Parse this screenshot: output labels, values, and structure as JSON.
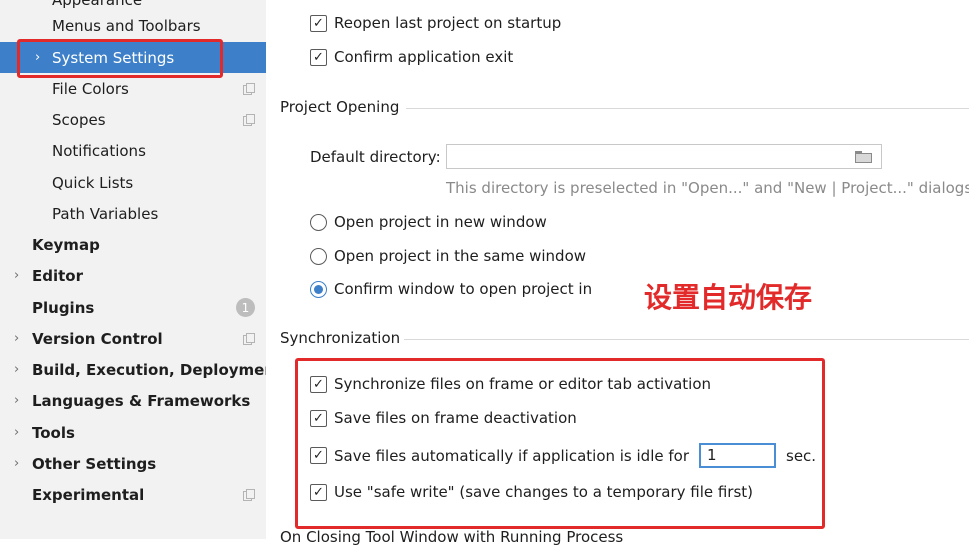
{
  "sidebar": {
    "partial_top_label": "Appearance",
    "items": [
      {
        "label": "Menus and Toolbars",
        "level": "sub"
      },
      {
        "label": "System Settings",
        "level": "sub",
        "selected": true,
        "arrow": "›"
      },
      {
        "label": "File Colors",
        "level": "sub",
        "copy_icon": true
      },
      {
        "label": "Scopes",
        "level": "sub",
        "copy_icon": true
      },
      {
        "label": "Notifications",
        "level": "sub"
      },
      {
        "label": "Quick Lists",
        "level": "sub"
      },
      {
        "label": "Path Variables",
        "level": "sub"
      },
      {
        "label": "Keymap",
        "level": "top"
      },
      {
        "label": "Editor",
        "level": "top",
        "arrow": "›"
      },
      {
        "label": "Plugins",
        "level": "top",
        "badge": "1"
      },
      {
        "label": "Version Control",
        "level": "top",
        "arrow": "›",
        "copy_icon": true
      },
      {
        "label": "Build, Execution, Deployment",
        "level": "top",
        "arrow": "›"
      },
      {
        "label": "Languages & Frameworks",
        "level": "top",
        "arrow": "›"
      },
      {
        "label": "Tools",
        "level": "top",
        "arrow": "›"
      },
      {
        "label": "Other Settings",
        "level": "top",
        "arrow": "›"
      },
      {
        "label": "Experimental",
        "level": "top",
        "copy_icon": true
      }
    ]
  },
  "startup": {
    "reopen_label": "Reopen last project on startup",
    "confirm_exit_label": "Confirm application exit"
  },
  "project_opening": {
    "title": "Project Opening",
    "default_dir_label": "Default directory:",
    "default_dir_value": "",
    "hint": "This directory is preselected in \"Open...\" and \"New | Project...\" dialogs.",
    "radio_new_window": "Open project in new window",
    "radio_same_window": "Open project in the same window",
    "radio_confirm": "Confirm window to open project in"
  },
  "annotation": "设置自动保存",
  "synchronization": {
    "title": "Synchronization",
    "sync_label": "Synchronize files on frame or editor tab activation",
    "save_deactivation_label": "Save files on frame deactivation",
    "save_idle_label": "Save files automatically if application is idle for",
    "idle_value": "1",
    "idle_unit": "sec.",
    "safe_write_label": "Use \"safe write\" (save changes to a temporary file first)"
  },
  "next_section_partial": "On Closing Tool Window with Running Process",
  "colors": {
    "selection": "#3d80c9",
    "annotation_red": "#e32a2a"
  }
}
